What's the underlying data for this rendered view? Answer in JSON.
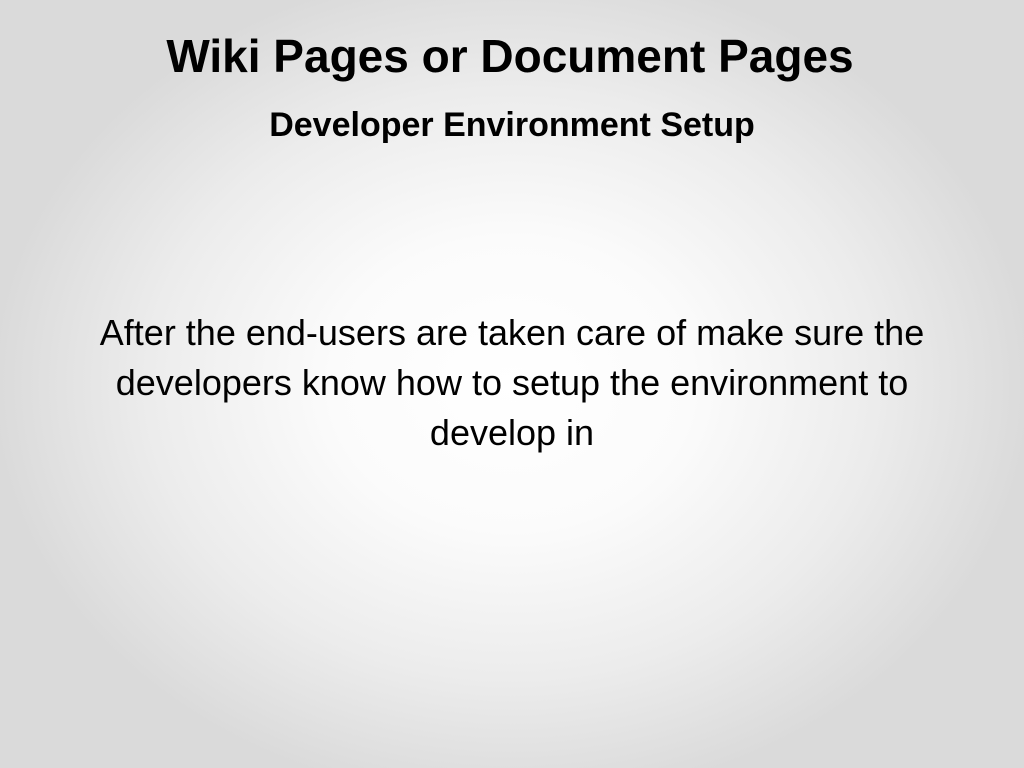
{
  "slide": {
    "title": "Wiki Pages or Document Pages",
    "subtitle": "Developer Environment Setup",
    "body": "After the end-users are taken care of make sure the developers know how to setup the environment to develop in"
  }
}
